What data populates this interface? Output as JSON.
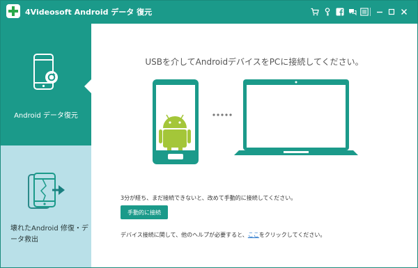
{
  "window": {
    "title": "4Videosoft Android データ 復元",
    "logo_icon": "plus-icon",
    "toolbar_icons": [
      "cart-icon",
      "key-icon",
      "facebook-icon",
      "feedback-icon",
      "menu-icon",
      "minimize-icon",
      "maximize-icon",
      "close-icon"
    ]
  },
  "sidebar": {
    "items": [
      {
        "label": "Android データ復元",
        "icon": "phone-recovery-icon",
        "active": true
      },
      {
        "label": "壊れたAndroid 修復・データ救出",
        "icon": "broken-phone-icon",
        "active": false
      }
    ]
  },
  "main": {
    "headline": "USBを介してAndroidデバイスをPCに接続してください。",
    "hint": "3分が経ち、まだ接続できないと、改めて手動的に接続してください。",
    "manual_button": "手動的に接続",
    "help_prefix": "デバイス接続に関して、他のヘルプが必要すると、",
    "help_link": "ここ",
    "help_suffix": "をクリックしてください。",
    "illustration": {
      "phone_icon": "android-phone-icon",
      "laptop_icon": "laptop-icon",
      "connector_icon": "dots-connector-icon"
    }
  },
  "colors": {
    "accent": "#1b9a8a",
    "sidebar_inactive": "#b9e0e8",
    "link": "#1a6fc9"
  }
}
